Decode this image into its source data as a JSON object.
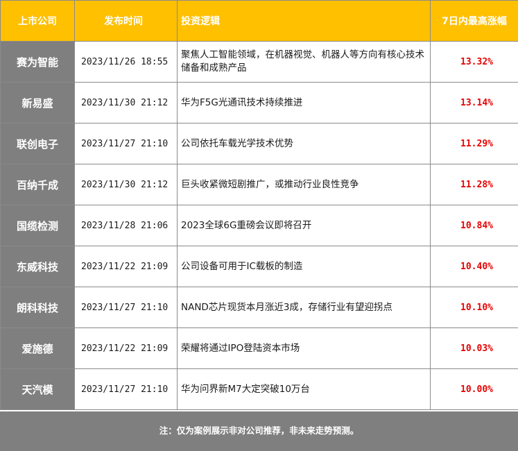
{
  "columns": {
    "company": "上市公司",
    "time": "发布时间",
    "logic": "投资逻辑",
    "gain": "7日内最高涨幅"
  },
  "rows": [
    {
      "company": "赛为智能",
      "time": "2023/11/26 18:55",
      "logic": "聚焦人工智能领域，在机器视觉、机器人等方向有核心技术储备和成熟产品",
      "gain": "13.32%"
    },
    {
      "company": "新易盛",
      "time": "2023/11/30 21:12",
      "logic": "华为F5G光通讯技术持续推进",
      "gain": "13.14%"
    },
    {
      "company": "联创电子",
      "time": "2023/11/27 21:10",
      "logic": "公司依托车载光学技术优势",
      "gain": "11.29%"
    },
    {
      "company": "百纳千成",
      "time": "2023/11/30 21:12",
      "logic": "巨头收紧微短剧推广，或推动行业良性竞争",
      "gain": "11.28%"
    },
    {
      "company": "国缆检测",
      "time": "2023/11/28 21:06",
      "logic": "2023全球6G重磅会议即将召开",
      "gain": "10.84%"
    },
    {
      "company": "东威科技",
      "time": "2023/11/22 21:09",
      "logic": "公司设备可用于IC载板的制造",
      "gain": "10.40%"
    },
    {
      "company": "朗科科技",
      "time": "2023/11/27 21:10",
      "logic": "NAND芯片现货本月涨近3成，存储行业有望迎拐点",
      "gain": "10.10%"
    },
    {
      "company": "爱施德",
      "time": "2023/11/22 21:09",
      "logic": "荣耀将通过IPO登陆资本市场",
      "gain": "10.03%"
    },
    {
      "company": "天汽模",
      "time": "2023/11/27 21:10",
      "logic": "华为问界新M7大定突破10万台",
      "gain": "10.00%"
    }
  ],
  "footer": "注：仅为案例展示非对公司推荐，非未来走势预测。",
  "colors": {
    "header_bg": "#ffc000",
    "company_bg": "#7f7f7f",
    "gain_red": "#e60000"
  }
}
